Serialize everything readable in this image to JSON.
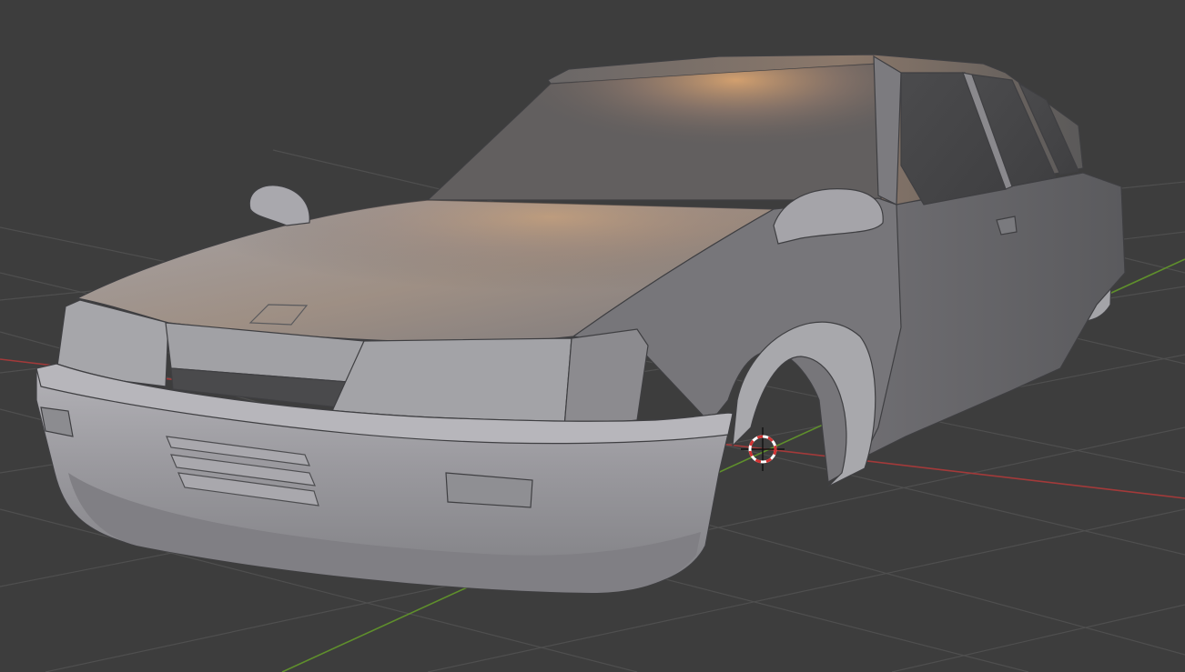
{
  "app": {
    "name": "3D viewport",
    "view": "solid-shading",
    "object": "car-body-mesh"
  },
  "scene": {
    "background_color": "#3d3d3d",
    "grid_color": "#4f4f4f",
    "x_axis_color": "#a33a3a",
    "y_axis_color": "#5f8f2c",
    "mesh_base_color": "#8f8f92",
    "mesh_highlight_color": "#c89a6a",
    "cursor_colors": [
      "#d23232",
      "#ffffff"
    ]
  },
  "icons": {
    "cursor": "3d-cursor-icon"
  }
}
